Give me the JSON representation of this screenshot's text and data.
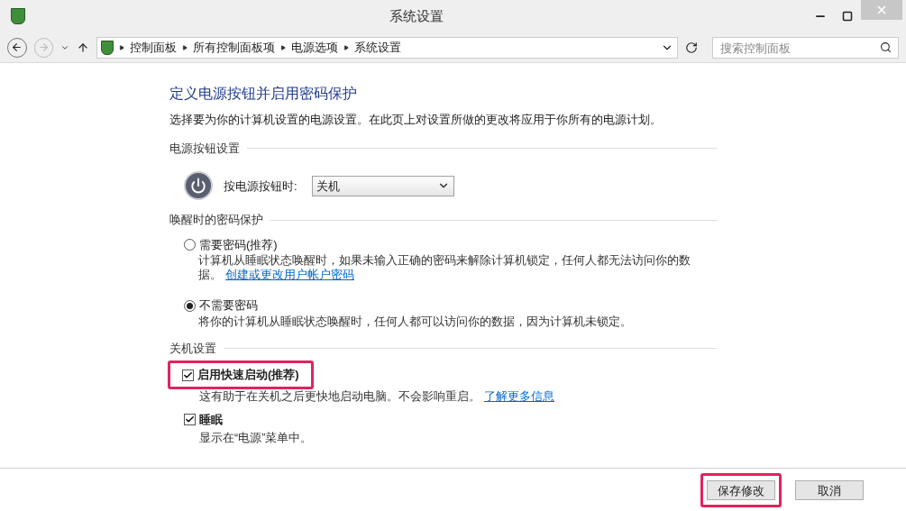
{
  "window": {
    "title": "系统设置"
  },
  "address_bar": {
    "path": [
      "控制面板",
      "所有控制面板项",
      "电源选项",
      "系统设置"
    ]
  },
  "search": {
    "placeholder": "搜索控制面板"
  },
  "heading": "定义电源按钮并启用密码保护",
  "intro": "选择要为你的计算机设置的电源设置。在此页上对设置所做的更改将应用于你所有的电源计划。",
  "sections": [
    {
      "title": "电源按钮设置",
      "kind": "dropdown",
      "label": "按电源按钮时:",
      "value": "关机"
    },
    {
      "title": "唤醒时的密码保护",
      "kind": "radio",
      "options": [
        {
          "label": "需要密码(推荐)",
          "selected": false,
          "description": "计算机从睡眠状态唤醒时，如果未输入正确的密码来解除计算机锁定，任何人都无法访问你的数据。",
          "link": "创建或更改用户帐户密码"
        },
        {
          "label": "不需要密码",
          "selected": true,
          "description": "将你的计算机从睡眠状态唤醒时，任何人都可以访问你的数据，因为计算机未锁定。"
        }
      ]
    },
    {
      "title": "关机设置",
      "kind": "checkbox",
      "options": [
        {
          "label": "启用快速启动(推荐)",
          "checked": true,
          "highlighted": true,
          "description": "这有助于在关机之后更快地启动电脑。不会影响重启。",
          "link": "了解更多信息"
        },
        {
          "label": "睡眠",
          "checked": true,
          "highlighted": false,
          "description": "显示在“电源”菜单中。"
        }
      ]
    }
  ],
  "buttons": [
    {
      "label": "保存修改",
      "highlighted": true
    },
    {
      "label": "取消",
      "highlighted": false
    }
  ]
}
